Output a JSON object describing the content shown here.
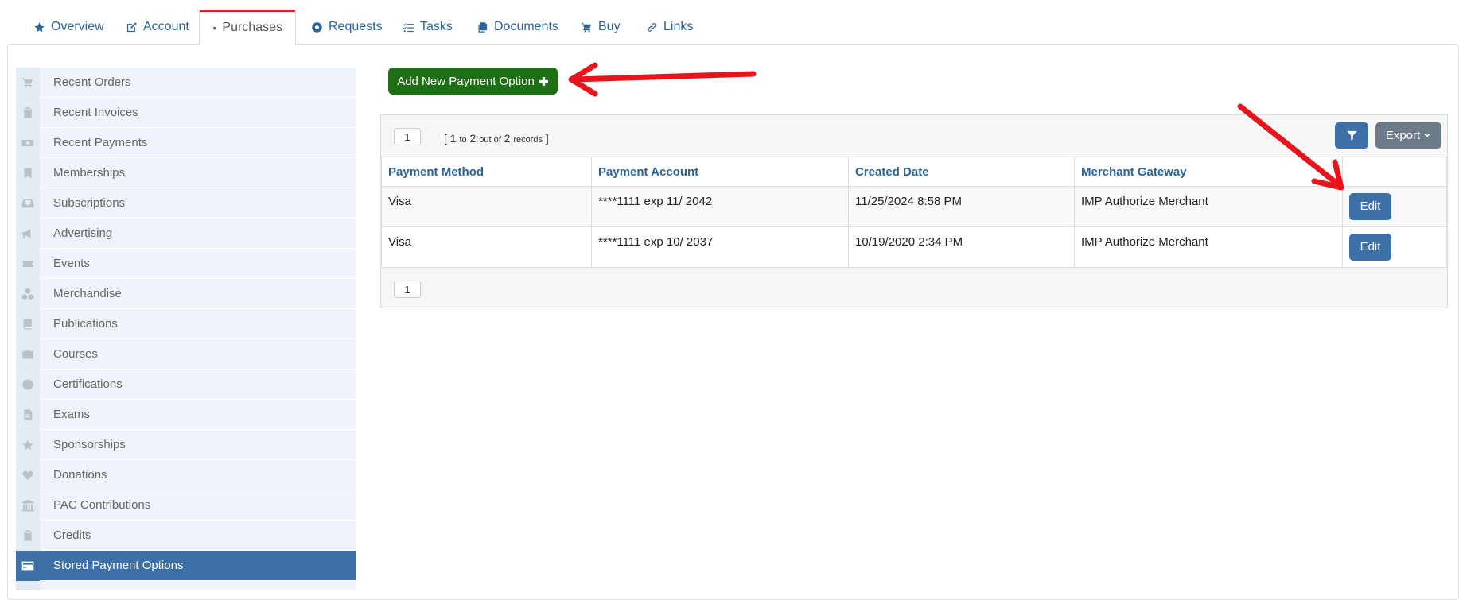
{
  "tabs": [
    {
      "label": "Overview",
      "icon": "star-icon"
    },
    {
      "label": "Account",
      "icon": "edit-icon"
    },
    {
      "label": "Purchases",
      "icon": "cart-icon",
      "active": true
    },
    {
      "label": "Requests",
      "icon": "lifebuoy-icon"
    },
    {
      "label": "Tasks",
      "icon": "checklist-icon"
    },
    {
      "label": "Documents",
      "icon": "documents-icon"
    },
    {
      "label": "Buy",
      "icon": "cart-icon"
    },
    {
      "label": "Links",
      "icon": "link-icon"
    }
  ],
  "sidebar": {
    "items": [
      {
        "label": "Recent Orders",
        "icon": "cart-icon"
      },
      {
        "label": "Recent Invoices",
        "icon": "clipboard-icon"
      },
      {
        "label": "Recent Payments",
        "icon": "money-icon"
      },
      {
        "label": "Memberships",
        "icon": "bookmark-icon"
      },
      {
        "label": "Subscriptions",
        "icon": "inbox-icon"
      },
      {
        "label": "Advertising",
        "icon": "megaphone-icon"
      },
      {
        "label": "Events",
        "icon": "ticket-icon"
      },
      {
        "label": "Merchandise",
        "icon": "cubes-icon"
      },
      {
        "label": "Publications",
        "icon": "book-icon"
      },
      {
        "label": "Courses",
        "icon": "briefcase-icon"
      },
      {
        "label": "Certifications",
        "icon": "certificate-icon"
      },
      {
        "label": "Exams",
        "icon": "file-icon"
      },
      {
        "label": "Sponsorships",
        "icon": "star-icon"
      },
      {
        "label": "Donations",
        "icon": "heart-icon"
      },
      {
        "label": "PAC Contributions",
        "icon": "bank-icon"
      },
      {
        "label": "Credits",
        "icon": "clipboard-icon"
      },
      {
        "label": "Stored Payment Options",
        "icon": "credit-card-icon",
        "active": true
      }
    ]
  },
  "main": {
    "add_button_label": "Add New Payment Option",
    "pager_top": "1",
    "pager_bottom": "1",
    "records": {
      "open": "[",
      "from": "1",
      "to_word": "to",
      "to": "2",
      "out_of": "out of",
      "total": "2",
      "records_word": "records",
      "close": "]"
    },
    "export_label": "Export",
    "columns": [
      "Payment Method",
      "Payment Account",
      "Created Date",
      "Merchant Gateway",
      ""
    ],
    "rows": [
      {
        "method": "Visa",
        "account": "****1111 exp 11/ 2042",
        "created": "11/25/2024 8:58 PM",
        "gateway": "IMP Authorize Merchant",
        "action": "Edit"
      },
      {
        "method": "Visa",
        "account": "****1111 exp 10/ 2037",
        "created": "10/19/2020 2:34 PM",
        "gateway": "IMP Authorize Merchant",
        "action": "Edit"
      }
    ]
  },
  "colors": {
    "active_tab_border": "#c9302c",
    "primary": "#3d70a6",
    "success": "#1d6e14",
    "annotation_arrow": "#e8141b"
  }
}
